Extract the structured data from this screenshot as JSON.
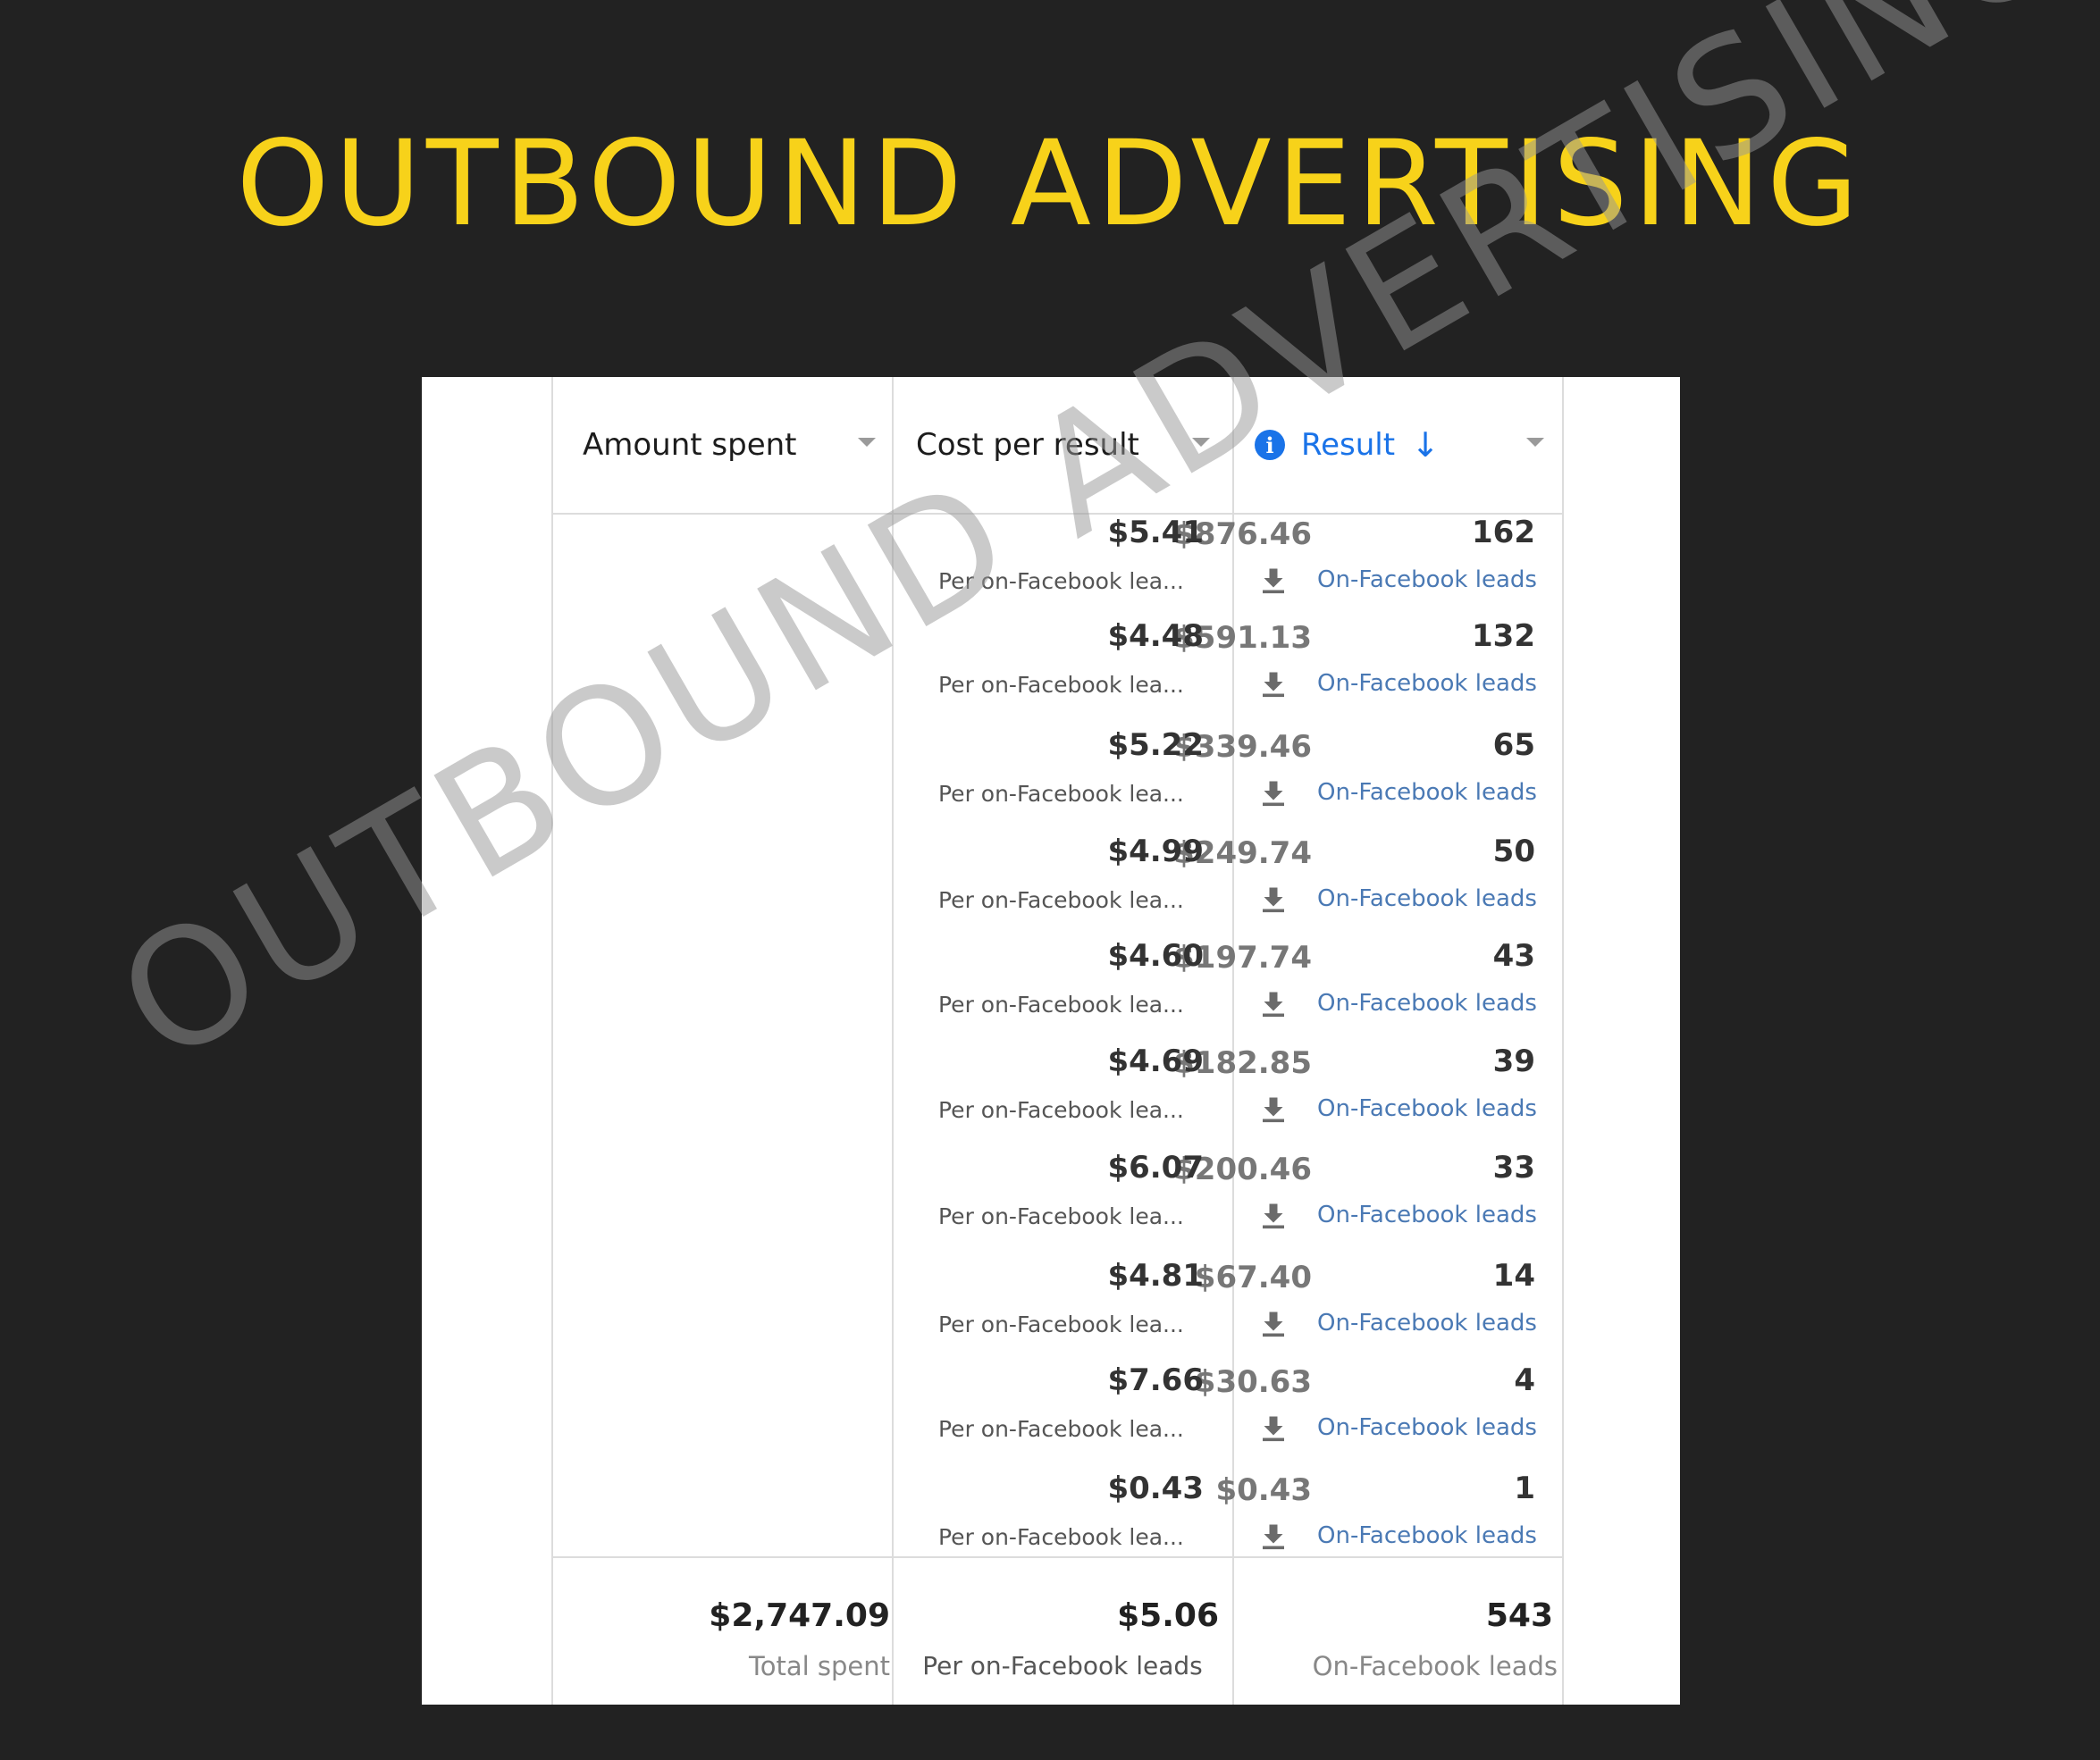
{
  "title": "OUTBOUND ADVERTISING",
  "watermark": "OUTBOUND ADVERTISING",
  "columns": {
    "amount_spent": "Amount spent",
    "cost_per_result": "Cost per result",
    "result": "Result",
    "info_icon": "i"
  },
  "rows": [
    {
      "amount": "$876.46",
      "cpr": "$5.41",
      "cpr_label": "Per on-Facebook lea...",
      "result": "162",
      "result_label": "On-Facebook leads"
    },
    {
      "amount": "$591.13",
      "cpr": "$4.48",
      "cpr_label": "Per on-Facebook lea...",
      "result": "132",
      "result_label": "On-Facebook leads"
    },
    {
      "amount": "$339.46",
      "cpr": "$5.22",
      "cpr_label": "Per on-Facebook lea...",
      "result": "65",
      "result_label": "On-Facebook leads"
    },
    {
      "amount": "$249.74",
      "cpr": "$4.99",
      "cpr_label": "Per on-Facebook lea...",
      "result": "50",
      "result_label": "On-Facebook leads"
    },
    {
      "amount": "$197.74",
      "cpr": "$4.60",
      "cpr_label": "Per on-Facebook lea...",
      "result": "43",
      "result_label": "On-Facebook leads"
    },
    {
      "amount": "$182.85",
      "cpr": "$4.69",
      "cpr_label": "Per on-Facebook lea...",
      "result": "39",
      "result_label": "On-Facebook leads"
    },
    {
      "amount": "$200.46",
      "cpr": "$6.07",
      "cpr_label": "Per on-Facebook lea...",
      "result": "33",
      "result_label": "On-Facebook leads"
    },
    {
      "amount": "$67.40",
      "cpr": "$4.81",
      "cpr_label": "Per on-Facebook lea...",
      "result": "14",
      "result_label": "On-Facebook leads"
    },
    {
      "amount": "$30.63",
      "cpr": "$7.66",
      "cpr_label": "Per on-Facebook lea...",
      "result": "4",
      "result_label": "On-Facebook leads"
    },
    {
      "amount": "$0.43",
      "cpr": "$0.43",
      "cpr_label": "Per on-Facebook lea...",
      "result": "1",
      "result_label": "On-Facebook leads"
    }
  ],
  "totals": {
    "amount": "$2,747.09",
    "amount_label": "Total spent",
    "cpr": "$5.06",
    "cpr_label": "Per on-Facebook leads",
    "result": "543",
    "result_label": "On-Facebook leads"
  },
  "colors": {
    "background": "#222222",
    "title": "#f7d21a",
    "link_blue": "#1a73e8",
    "result_label": "#4a79b4"
  }
}
